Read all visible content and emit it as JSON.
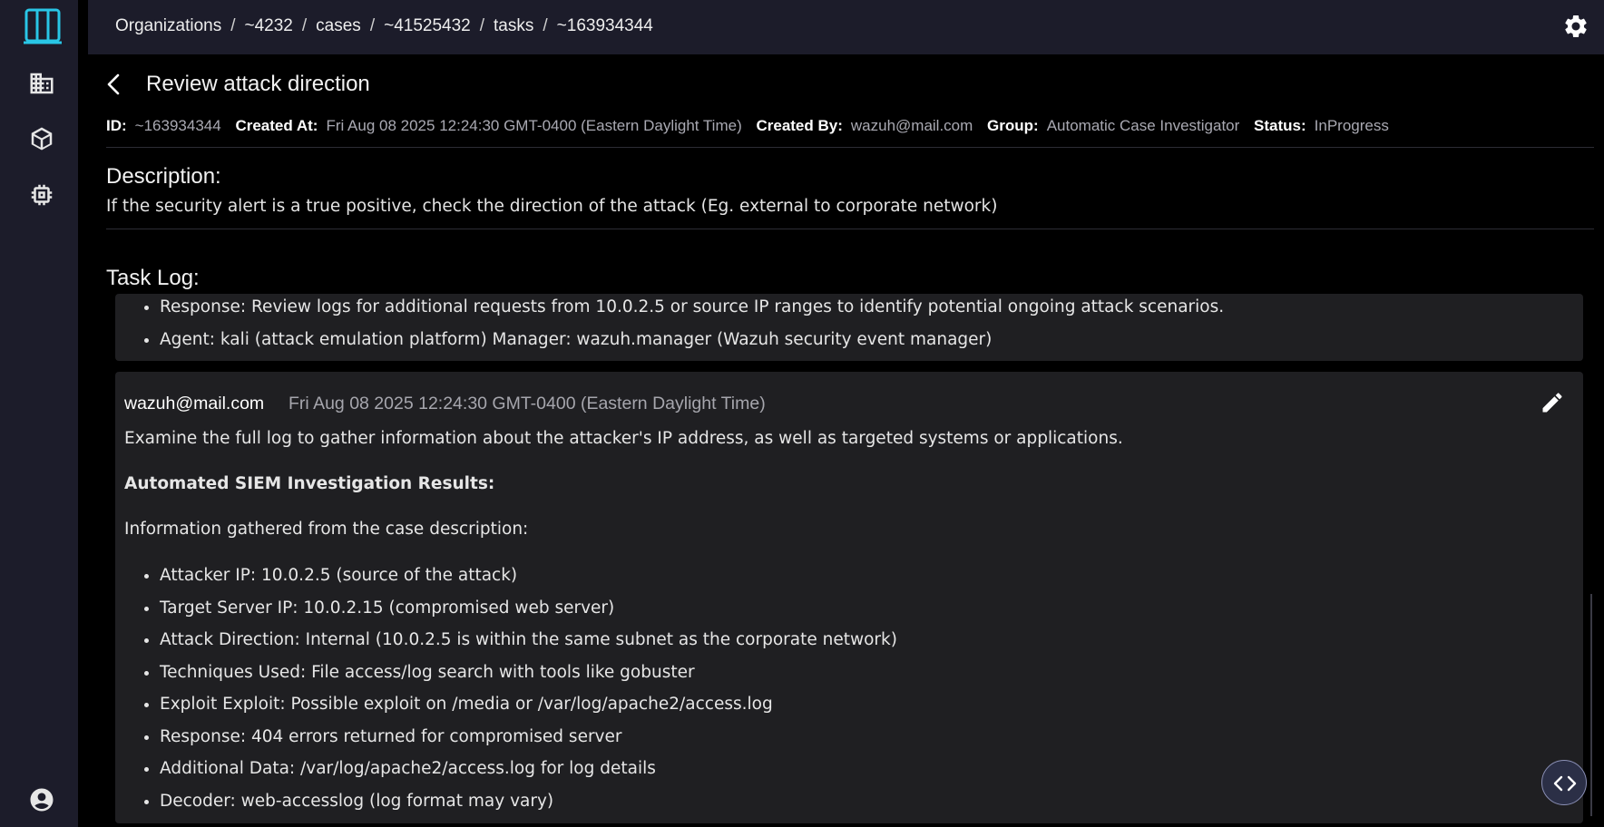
{
  "breadcrumb": [
    {
      "label": "Organizations"
    },
    {
      "label": "~4232"
    },
    {
      "label": "cases"
    },
    {
      "label": "~41525432"
    },
    {
      "label": "tasks"
    },
    {
      "label": "~163934344"
    }
  ],
  "breadcrumb_separator": "/",
  "sidebar": {
    "items": [
      {
        "icon": "organizations-icon"
      },
      {
        "icon": "packages-icon"
      },
      {
        "icon": "chip-icon"
      },
      {
        "icon": "account-icon"
      }
    ]
  },
  "task": {
    "title": "Review attack direction",
    "meta": {
      "id_label": "ID:",
      "id": "~163934344",
      "created_at_label": "Created At:",
      "created_at": "Fri Aug 08 2025 12:24:30 GMT-0400 (Eastern Daylight Time)",
      "created_by_label": "Created By:",
      "created_by": "wazuh@mail.com",
      "group_label": "Group:",
      "group": "Automatic Case Investigator",
      "status_label": "Status:",
      "status": "InProgress"
    },
    "description_heading": "Description:",
    "description": "If the security alert is a true positive, check the direction of the attack (Eg. external to corporate network)",
    "task_log_heading": "Task Log:"
  },
  "log_entries": [
    {
      "bullets": [
        "Response: Review logs for additional requests from 10.0.2.5 or source IP ranges to identify potential ongoing attack scenarios.",
        "Agent: kali (attack emulation platform) Manager: wazuh.manager (Wazuh security event manager)"
      ]
    },
    {
      "user": "wazuh@mail.com",
      "date": "Fri Aug 08 2025 12:24:30 GMT-0400 (Eastern Daylight Time)",
      "paragraph1": "Examine the full log to gather information about the attacker's IP address, as well as targeted systems or applications.",
      "heading": "Automated SIEM Investigation Results:",
      "paragraph2": "Information gathered from the case description:",
      "bullets": [
        "Attacker IP: 10.0.2.5 (source of the attack)",
        "Target Server IP: 10.0.2.15 (compromised web server)",
        "Attack Direction: Internal (10.0.2.5 is within the same subnet as the corporate network)",
        "Techniques Used: File access/log search with tools like gobuster",
        "Exploit Exploit: Possible exploit on /media or /var/log/apache2/access.log",
        "Response: 404 errors returned for compromised server",
        "Additional Data: /var/log/apache2/access.log for log details",
        "Decoder: web-accesslog (log format may vary)"
      ]
    }
  ],
  "colors": {
    "sidebar_bg": "#1c1c2a",
    "accent": "#29c6e6",
    "card_bg": "#1f1f22",
    "page_bg": "#000000"
  }
}
